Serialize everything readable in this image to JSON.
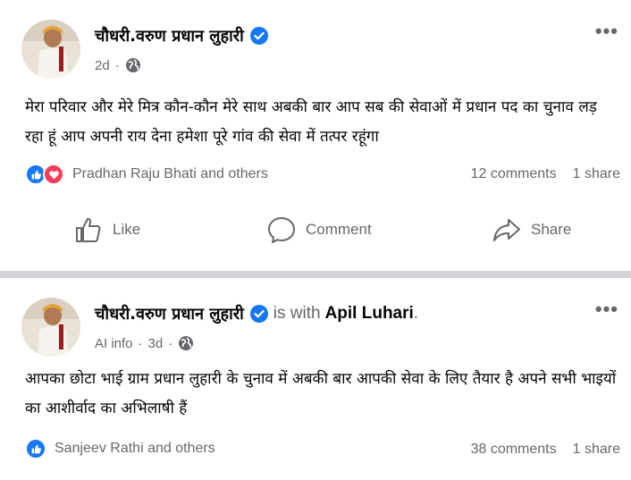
{
  "posts": [
    {
      "author": "चौधरी.वरुण प्रधान लुहारी",
      "time": "2d",
      "separator": "·",
      "text": "मेरा परिवार और मेरे मित्र कौन-कौन मेरे साथ अबकी बार आप सब की सेवाओं में प्रधान पद का चुनाव लड़ रहा हूं आप अपनी राय देना हमेशा पूरे गांव की सेवा में तत्पर रहूंगा",
      "reactions_text": "Pradhan Raju Bhati and others",
      "comments": "12 comments",
      "shares": "1 share",
      "actions": {
        "like": "Like",
        "comment": "Comment",
        "share": "Share"
      },
      "more": "•••"
    },
    {
      "author": "चौधरी.वरुण प्रधान लुहारी",
      "with_text": "is with",
      "tagged": "Apil Luhari",
      "tagged_end": ".",
      "ai_info": "AI info",
      "time": "3d",
      "separator": "·",
      "text": "आपका छोटा भाई ग्राम प्रधान लुहारी के चुनाव में अबकी बार आपकी सेवा के लिए तैयार है अपने सभी भाइयों का आशीर्वाद का अभिलाषी हैं",
      "reactions_text": "Sanjeev Rathi and others",
      "comments": "38 comments",
      "shares": "1 share",
      "more": "•••"
    }
  ],
  "icons": {
    "verified": "verified-badge-icon",
    "globe": "globe-icon",
    "like_reaction": "like-reaction-icon",
    "love_reaction": "love-reaction-icon",
    "like": "thumbs-up-icon",
    "comment": "comment-bubble-icon",
    "share": "share-arrow-icon"
  },
  "colors": {
    "brand_blue": "#1877f2",
    "love_red": "#f33e58",
    "secondary_text": "#65676b",
    "divider": "#d2d4d8"
  }
}
